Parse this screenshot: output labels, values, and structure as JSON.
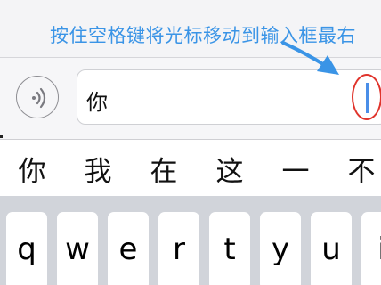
{
  "annotation": {
    "text": "按住空格键将光标移动到输入框最右"
  },
  "input": {
    "value": "你"
  },
  "candidates": [
    "你",
    "我",
    "在",
    "这",
    "一",
    "不"
  ],
  "keyboard": {
    "row1": [
      "q",
      "w",
      "e",
      "r",
      "t",
      "y",
      "u",
      "i"
    ]
  },
  "colors": {
    "annotation": "#3a94e6",
    "cursor": "#4a8ee8",
    "highlight_ring": "#e0342c",
    "keyboard_bg": "#d1d4da"
  },
  "icons": {
    "voice_button": "speaker-wave-icon"
  }
}
